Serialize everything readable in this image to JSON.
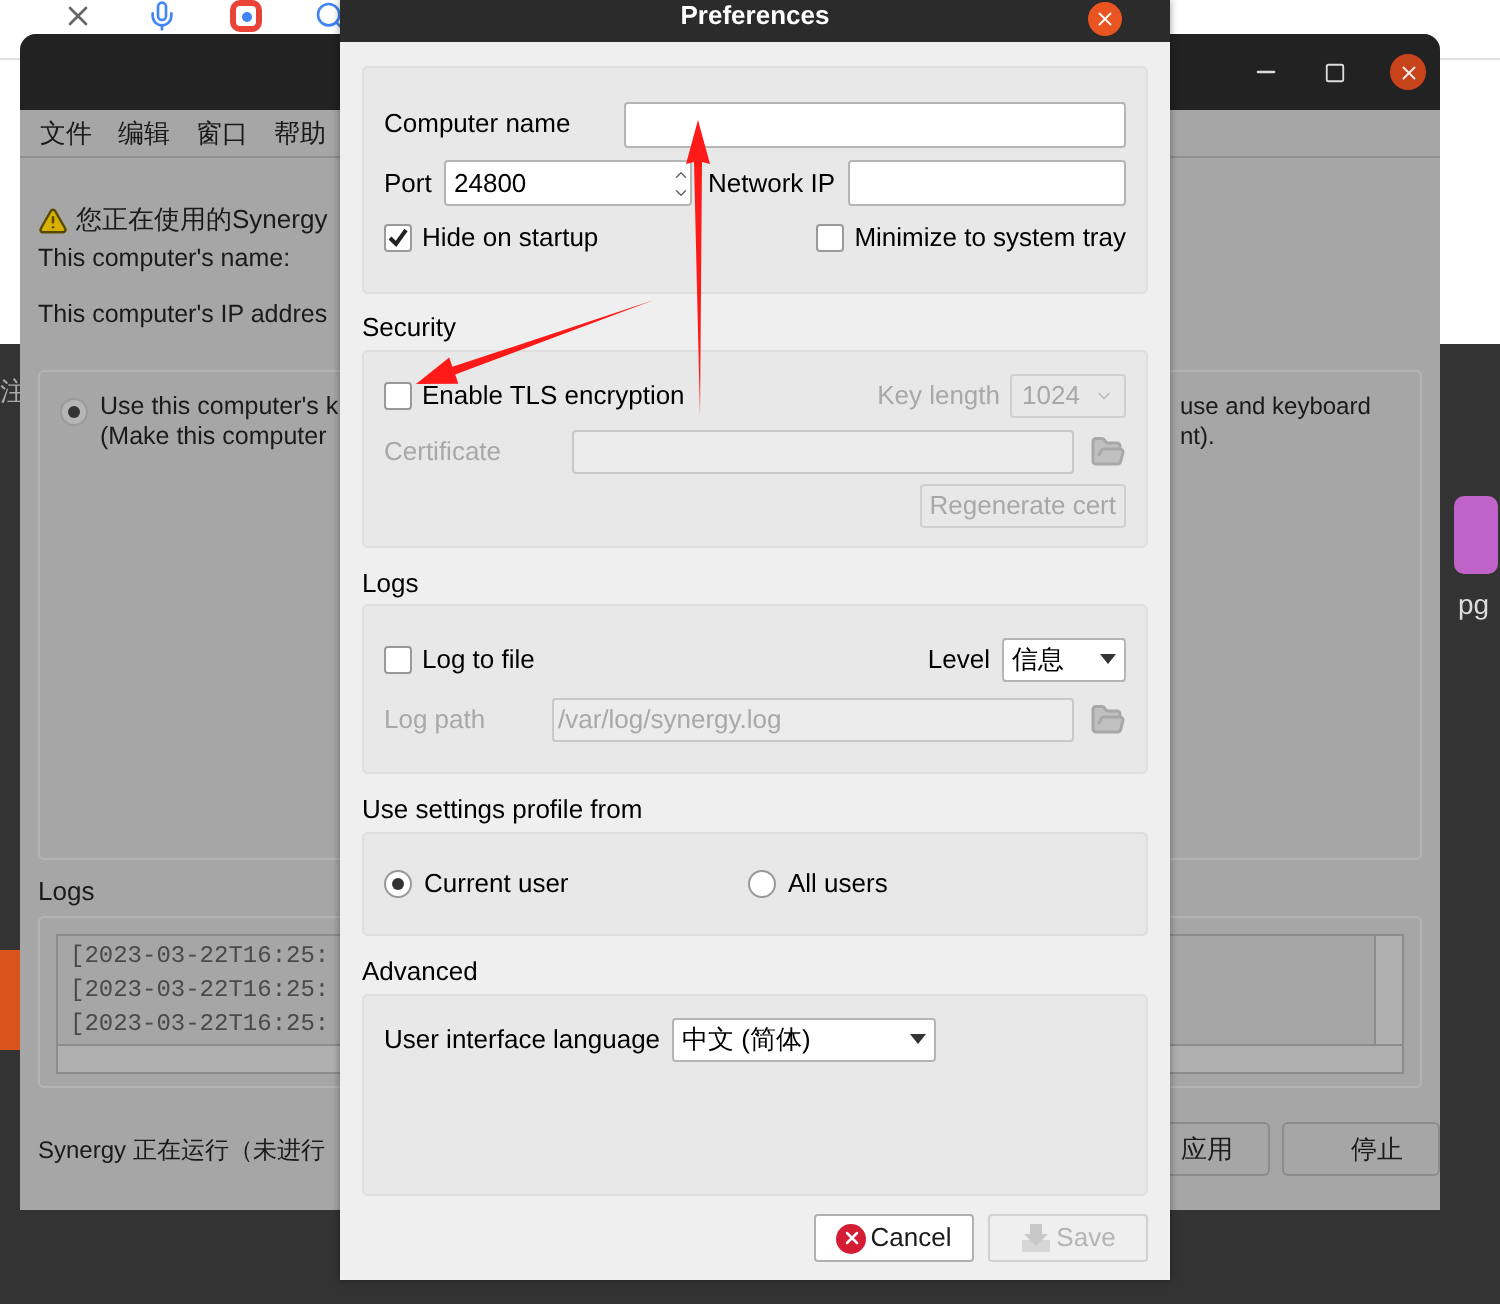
{
  "desktop": {
    "left_edge_texts": [
      "注"
    ],
    "right_edge_text": "pg"
  },
  "main_window": {
    "menu": [
      "文件",
      "编辑",
      "窗口",
      "帮助"
    ],
    "warning": "您正在使用的Synergy",
    "name_label": "This computer's name:",
    "ip_label": "This computer's IP addres",
    "mode": {
      "selected": true,
      "lines": [
        "Use this computer's k",
        "(Make this computer"
      ],
      "tail_lines": [
        "use and keyboard",
        "nt)."
      ]
    },
    "logs_title": "Logs",
    "log_lines": [
      "[2023-03-22T16:25:",
      "[2023-03-22T16:25:",
      "[2023-03-22T16:25:"
    ],
    "status": "Synergy 正在运行（未进行",
    "buttons": [
      "应用",
      "停止"
    ]
  },
  "preferences": {
    "title": "Preferences",
    "general": {
      "computer_name": {
        "label": "Computer name"
      },
      "port": {
        "label": "Port",
        "value": "24800"
      },
      "network_ip": {
        "label": "Network IP"
      },
      "options": [
        {
          "label": "Hide on startup",
          "checked": true
        },
        {
          "label": "Minimize to system tray",
          "checked": false
        }
      ]
    },
    "security": {
      "title": "Security",
      "tls": {
        "label": "Enable TLS encryption",
        "checked": false
      },
      "key_length": {
        "label": "Key length",
        "value": "1024",
        "disabled": true
      },
      "certificate": {
        "label": "Certificate",
        "disabled": true
      },
      "regenerate": {
        "label": "Regenerate cert",
        "disabled": true
      }
    },
    "logs": {
      "title": "Logs",
      "log_to_file": {
        "label": "Log to file",
        "checked": false
      },
      "level": {
        "label": "Level",
        "value": "信息"
      },
      "log_path": {
        "label": "Log path",
        "value": "/var/log/synergy.log",
        "disabled": true
      }
    },
    "profile": {
      "title": "Use settings profile from",
      "options": [
        {
          "label": "Current user",
          "selected": true
        },
        {
          "label": "All users",
          "selected": false
        }
      ]
    },
    "advanced": {
      "title": "Advanced",
      "language": {
        "label": "User interface language",
        "value": "中文 (简体)"
      }
    },
    "buttons": [
      {
        "label": "Cancel",
        "kind": "cancel",
        "disabled": false
      },
      {
        "label": "Save",
        "kind": "save",
        "disabled": true
      }
    ]
  }
}
